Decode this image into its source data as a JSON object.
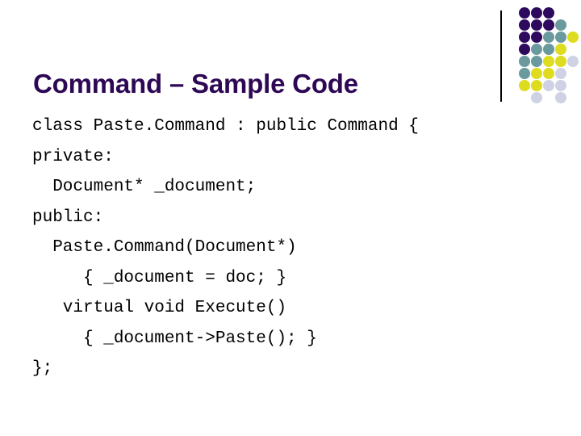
{
  "slide": {
    "title": "Command – Sample Code",
    "background_color": "#ffffff",
    "title_color": "#2e0854"
  },
  "code": {
    "language": "cpp",
    "lines": [
      "class Paste.Command : public Command {",
      "private:",
      "  Document* _document;",
      "public:",
      "  Paste.Command(Document*)",
      "     { _document = doc; }",
      "   virtual void Execute()",
      "     { _document->Paste(); }",
      "};"
    ]
  },
  "decoration": {
    "vertical_rule_color": "#000000",
    "palette": {
      "purple": "#2e0a5e",
      "teal": "#6b9a9e",
      "yellow": "#dedc1e",
      "lavender": "#ced2e4"
    },
    "dot_grid": {
      "columns": 5,
      "rows": 8,
      "cell_size": 15,
      "dots": [
        {
          "col": 0,
          "row": 0,
          "color": "purple"
        },
        {
          "col": 1,
          "row": 0,
          "color": "purple"
        },
        {
          "col": 2,
          "row": 0,
          "color": "purple"
        },
        {
          "col": 0,
          "row": 1,
          "color": "purple"
        },
        {
          "col": 1,
          "row": 1,
          "color": "purple"
        },
        {
          "col": 2,
          "row": 1,
          "color": "purple"
        },
        {
          "col": 3,
          "row": 1,
          "color": "teal"
        },
        {
          "col": 0,
          "row": 2,
          "color": "purple"
        },
        {
          "col": 1,
          "row": 2,
          "color": "purple"
        },
        {
          "col": 2,
          "row": 2,
          "color": "teal"
        },
        {
          "col": 3,
          "row": 2,
          "color": "teal"
        },
        {
          "col": 4,
          "row": 2,
          "color": "yellow"
        },
        {
          "col": 0,
          "row": 3,
          "color": "purple"
        },
        {
          "col": 1,
          "row": 3,
          "color": "teal"
        },
        {
          "col": 2,
          "row": 3,
          "color": "teal"
        },
        {
          "col": 3,
          "row": 3,
          "color": "yellow"
        },
        {
          "col": 0,
          "row": 4,
          "color": "teal"
        },
        {
          "col": 1,
          "row": 4,
          "color": "teal"
        },
        {
          "col": 2,
          "row": 4,
          "color": "yellow"
        },
        {
          "col": 3,
          "row": 4,
          "color": "yellow"
        },
        {
          "col": 4,
          "row": 4,
          "color": "lavender"
        },
        {
          "col": 0,
          "row": 5,
          "color": "teal"
        },
        {
          "col": 1,
          "row": 5,
          "color": "yellow"
        },
        {
          "col": 2,
          "row": 5,
          "color": "yellow"
        },
        {
          "col": 3,
          "row": 5,
          "color": "lavender"
        },
        {
          "col": 0,
          "row": 6,
          "color": "yellow"
        },
        {
          "col": 1,
          "row": 6,
          "color": "yellow"
        },
        {
          "col": 2,
          "row": 6,
          "color": "lavender"
        },
        {
          "col": 3,
          "row": 6,
          "color": "lavender"
        },
        {
          "col": 1,
          "row": 7,
          "color": "lavender"
        },
        {
          "col": 3,
          "row": 7,
          "color": "lavender"
        }
      ]
    }
  }
}
